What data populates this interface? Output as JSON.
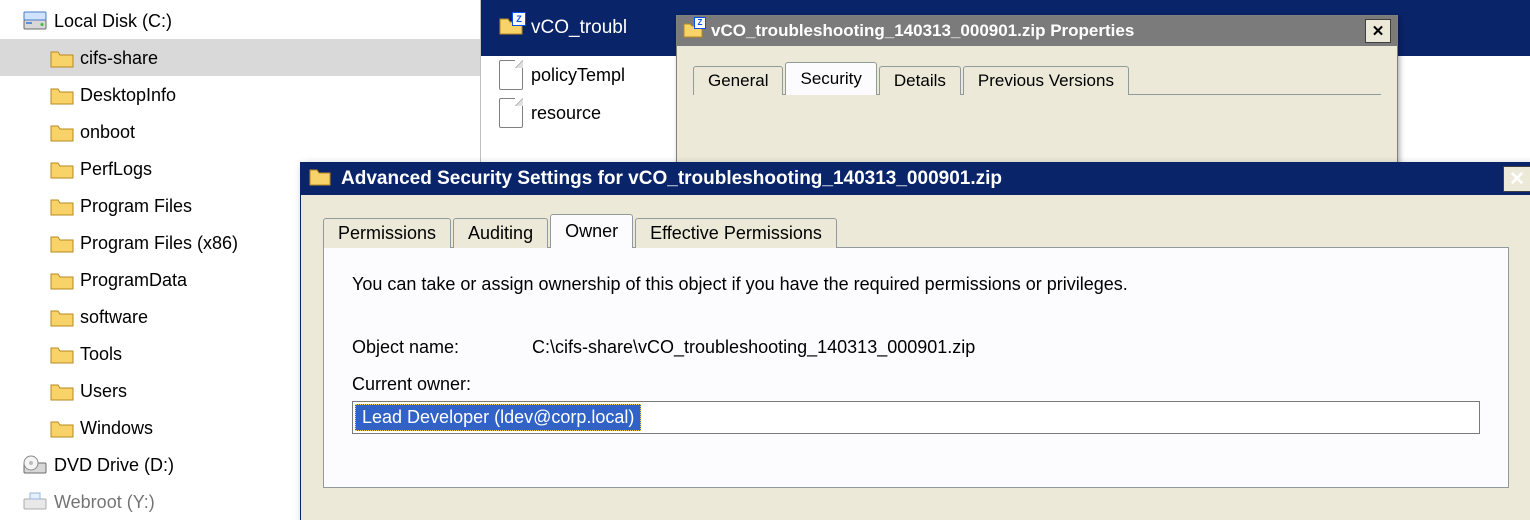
{
  "tree": {
    "root_label": "Local Disk (C:)",
    "items": [
      {
        "label": "cifs-share",
        "selected": true
      },
      {
        "label": "DesktopInfo"
      },
      {
        "label": "onboot"
      },
      {
        "label": "PerfLogs"
      },
      {
        "label": "Program Files"
      },
      {
        "label": "Program Files (x86)"
      },
      {
        "label": "ProgramData"
      },
      {
        "label": "software"
      },
      {
        "label": "Tools"
      },
      {
        "label": "Users"
      },
      {
        "label": "Windows"
      }
    ],
    "drive2_label": "DVD Drive (D:)",
    "drive3_label": "Webroot (Y:)"
  },
  "folder_header": {
    "title": "vCO_troubl"
  },
  "files": [
    {
      "label": "policyTempl"
    },
    {
      "label": "resource"
    }
  ],
  "props": {
    "title": "vCO_troubleshooting_140313_000901.zip Properties",
    "tabs": [
      "General",
      "Security",
      "Details",
      "Previous Versions"
    ],
    "active_tab": 1
  },
  "adv": {
    "title": "Advanced Security Settings for vCO_troubleshooting_140313_000901.zip",
    "tabs": [
      "Permissions",
      "Auditing",
      "Owner",
      "Effective Permissions"
    ],
    "active_tab": 2,
    "description": "You can take or assign ownership of this object if you have the required permissions or privileges.",
    "objectname_label": "Object name:",
    "objectname_value": "C:\\cifs-share\\vCO_troubleshooting_140313_000901.zip",
    "currentowner_label": "Current owner:",
    "currentowner_value": "Lead Developer (ldev@corp.local)"
  },
  "icons": {
    "close": "✕"
  }
}
